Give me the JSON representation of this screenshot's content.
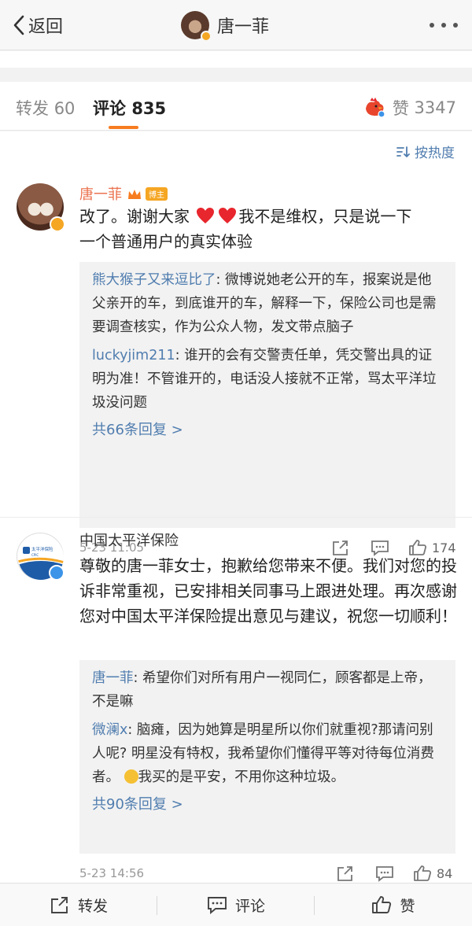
{
  "nav": {
    "back_label": "返回",
    "title": "唐一菲"
  },
  "tabs": {
    "forward_label": "转发",
    "forward_count": "60",
    "comment_label": "评论",
    "comment_count": "835",
    "like_label": "赞",
    "like_count": "3347"
  },
  "sort": {
    "label": "按热度"
  },
  "comments": [
    {
      "user": "唐一菲",
      "badge": "博主",
      "text_line1": "改了。谢谢大家",
      "text_line1b": "我不是维权，只是说一下",
      "text_line2": "一个普通用户的真实体验",
      "replies": [
        {
          "name": "熊大猴子又来逗比了",
          "text": ": 微博说她老公开的车，报案说是他父亲开的车，到底谁开的车，解释一下，保险公司也是需要调查核实，作为公众人物，发文带点脑子"
        },
        {
          "name": "luckyjim211",
          "text": ": 谁开的会有交警责任单，凭交警出具的证明为准！不管谁开的，电话没人接就不正常，骂太平洋垃圾没问题"
        }
      ],
      "more_replies": "共66条回复 >",
      "time": "5-23 11:05",
      "likes": "174"
    },
    {
      "user": "中国太平洋保险",
      "avatar_text": "太平洋保险",
      "avatar_sub": "CPIC",
      "text": "尊敬的唐一菲女士，抱歉给您带来不便。我们对您的投诉非常重视，已安排相关同事马上跟进处理。再次感谢您对中国太平洋保险提出意见与建议，祝您一切顺利！",
      "replies": [
        {
          "name": "唐一菲",
          "text": ": 希望你们对所有用户一视同仁，顾客都是上帝，不是嘛"
        },
        {
          "name": "微澜x",
          "text_a": ": 脑瘫，因为她算是明星所以你们就重视?那请问别人呢? 明星没有特权，我希望你们懂得平等对待每位消费者。",
          "text_b": "我买的是平安，不用你这种垃圾。"
        }
      ],
      "more_replies": "共90条回复 >",
      "time": "5-23 14:56",
      "likes": "84"
    }
  ],
  "bottom": {
    "forward": "转发",
    "comment": "评论",
    "like": "赞"
  },
  "colors": {
    "accent": "#f77c20",
    "link": "#507daf",
    "username": "#eb7350",
    "heart": "#e8262d"
  }
}
